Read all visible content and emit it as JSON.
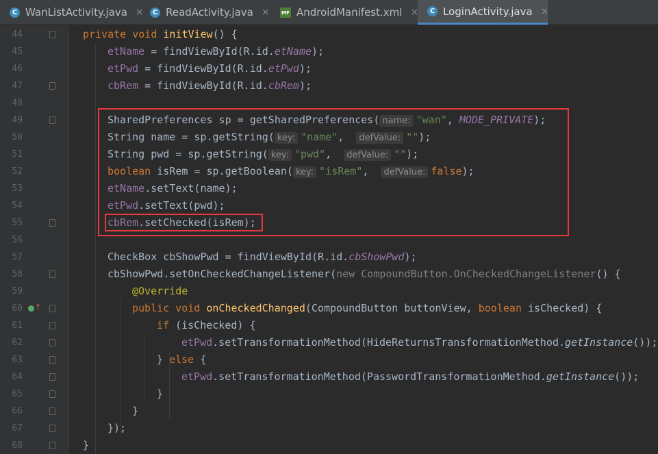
{
  "tabs": [
    {
      "label": "WanListActivity.java",
      "icon": "java-class-icon",
      "icon_glyph": "C",
      "active": false
    },
    {
      "label": "ReadActivity.java",
      "icon": "java-class-icon",
      "icon_glyph": "C",
      "active": false
    },
    {
      "label": "AndroidManifest.xml",
      "icon": "manifest-file-icon",
      "icon_glyph": "MF",
      "active": false
    },
    {
      "label": "LoginActivity.java",
      "icon": "java-class-icon",
      "icon_glyph": "C",
      "active": true
    }
  ],
  "close_glyph": "×",
  "lines": [
    {
      "num": "44",
      "indent": 0,
      "tokens": [
        {
          "t": "private void ",
          "c": "kw"
        },
        {
          "t": "initView",
          "c": "fn"
        },
        {
          "t": "() {"
        }
      ]
    },
    {
      "num": "45",
      "indent": 1,
      "tokens": [
        {
          "t": "etName",
          "c": "fld"
        },
        {
          "t": " = findViewById(R.id."
        },
        {
          "t": "etName",
          "c": "ifld"
        },
        {
          "t": ");"
        }
      ]
    },
    {
      "num": "46",
      "indent": 1,
      "tokens": [
        {
          "t": "etPwd",
          "c": "fld"
        },
        {
          "t": " = findViewById(R.id."
        },
        {
          "t": "etPwd",
          "c": "ifld"
        },
        {
          "t": ");"
        }
      ]
    },
    {
      "num": "47",
      "indent": 1,
      "tokens": [
        {
          "t": "cbRem",
          "c": "fld"
        },
        {
          "t": " = findViewById(R.id."
        },
        {
          "t": "cbRem",
          "c": "ifld"
        },
        {
          "t": ");"
        }
      ]
    },
    {
      "num": "48",
      "indent": 0,
      "tokens": []
    },
    {
      "num": "49",
      "indent": 1,
      "tokens": [
        {
          "t": "SharedPreferences sp = getSharedPreferences("
        },
        {
          "t": "name:",
          "c": "hint"
        },
        {
          "t": "\"wan\"",
          "c": "str"
        },
        {
          "t": ", "
        },
        {
          "t": "MODE_PRIVATE",
          "c": "ifld"
        },
        {
          "t": ");"
        }
      ]
    },
    {
      "num": "50",
      "indent": 1,
      "tokens": [
        {
          "t": "String name = sp.getString("
        },
        {
          "t": "key:",
          "c": "hint"
        },
        {
          "t": "\"name\"",
          "c": "str"
        },
        {
          "t": ",  "
        },
        {
          "t": "defValue:",
          "c": "hint"
        },
        {
          "t": "\"\"",
          "c": "str"
        },
        {
          "t": ");"
        }
      ]
    },
    {
      "num": "51",
      "indent": 1,
      "tokens": [
        {
          "t": "String pwd = sp.getString("
        },
        {
          "t": "key:",
          "c": "hint"
        },
        {
          "t": "\"pwd\"",
          "c": "str"
        },
        {
          "t": ",  "
        },
        {
          "t": "defValue:",
          "c": "hint"
        },
        {
          "t": "\"\"",
          "c": "str"
        },
        {
          "t": ");"
        }
      ]
    },
    {
      "num": "52",
      "indent": 1,
      "tokens": [
        {
          "t": "boolean ",
          "c": "kw"
        },
        {
          "t": "isRem = sp.getBoolean("
        },
        {
          "t": "key:",
          "c": "hint"
        },
        {
          "t": "\"isRem\"",
          "c": "str"
        },
        {
          "t": ",  "
        },
        {
          "t": "defValue:",
          "c": "hint"
        },
        {
          "t": "false",
          "c": "kw"
        },
        {
          "t": ");"
        }
      ]
    },
    {
      "num": "53",
      "indent": 1,
      "tokens": [
        {
          "t": "etName",
          "c": "fld"
        },
        {
          "t": ".setText(name);"
        }
      ]
    },
    {
      "num": "54",
      "indent": 1,
      "tokens": [
        {
          "t": "etPwd",
          "c": "fld"
        },
        {
          "t": ".setText(pwd);"
        }
      ]
    },
    {
      "num": "55",
      "indent": 1,
      "tokens": [
        {
          "t": "cbRem",
          "c": "fld"
        },
        {
          "t": ".setChecked(isRem);"
        }
      ]
    },
    {
      "num": "56",
      "indent": 0,
      "tokens": []
    },
    {
      "num": "57",
      "indent": 1,
      "tokens": [
        {
          "t": "CheckBox cbShowPwd = findViewById(R.id."
        },
        {
          "t": "cbShowPwd",
          "c": "ifld"
        },
        {
          "t": ");"
        }
      ]
    },
    {
      "num": "58",
      "indent": 1,
      "tokens": [
        {
          "t": "cbShowPwd.setOnCheckedChangeListener("
        },
        {
          "t": "new CompoundButton.OnCheckedChangeListener",
          "c": "cmt"
        },
        {
          "t": "() {"
        }
      ]
    },
    {
      "num": "59",
      "indent": 2,
      "tokens": [
        {
          "t": "@Override",
          "c": "ann"
        }
      ]
    },
    {
      "num": "60",
      "indent": 2,
      "tokens": [
        {
          "t": "public void ",
          "c": "kw"
        },
        {
          "t": "onCheckedChanged",
          "c": "fn"
        },
        {
          "t": "(CompoundButton buttonView, "
        },
        {
          "t": "boolean ",
          "c": "kw"
        },
        {
          "t": "isChecked) {"
        }
      ]
    },
    {
      "num": "61",
      "indent": 3,
      "tokens": [
        {
          "t": "if ",
          "c": "kw"
        },
        {
          "t": "(isChecked) {"
        }
      ]
    },
    {
      "num": "62",
      "indent": 4,
      "tokens": [
        {
          "t": "etPwd",
          "c": "fld"
        },
        {
          "t": ".setTransformationMethod(HideReturnsTransformationMethod."
        },
        {
          "t": "getInstance",
          "c": "it"
        },
        {
          "t": "());"
        }
      ]
    },
    {
      "num": "63",
      "indent": 3,
      "tokens": [
        {
          "t": "} "
        },
        {
          "t": "else ",
          "c": "kw"
        },
        {
          "t": "{"
        }
      ]
    },
    {
      "num": "64",
      "indent": 4,
      "tokens": [
        {
          "t": "etPwd",
          "c": "fld"
        },
        {
          "t": ".setTransformationMethod(PasswordTransformationMethod."
        },
        {
          "t": "getInstance",
          "c": "it"
        },
        {
          "t": "());"
        }
      ]
    },
    {
      "num": "65",
      "indent": 3,
      "tokens": [
        {
          "t": "}"
        }
      ]
    },
    {
      "num": "66",
      "indent": 2,
      "tokens": [
        {
          "t": "}"
        }
      ]
    },
    {
      "num": "67",
      "indent": 1,
      "tokens": [
        {
          "t": "});"
        }
      ]
    },
    {
      "num": "68",
      "indent": 0,
      "tokens": [
        {
          "t": "}"
        }
      ]
    }
  ],
  "fold_marker_lines": [
    "44",
    "47",
    "49",
    "55",
    "58",
    "60",
    "61",
    "62",
    "63",
    "64",
    "65",
    "66",
    "67",
    "68"
  ],
  "override_marker_line": "60",
  "colors": {
    "highlight_box": "#e8383d",
    "keyword": "#cc7832",
    "method": "#ffc66d",
    "field": "#9876aa",
    "string": "#6a8759",
    "annotation": "#bbb529"
  }
}
